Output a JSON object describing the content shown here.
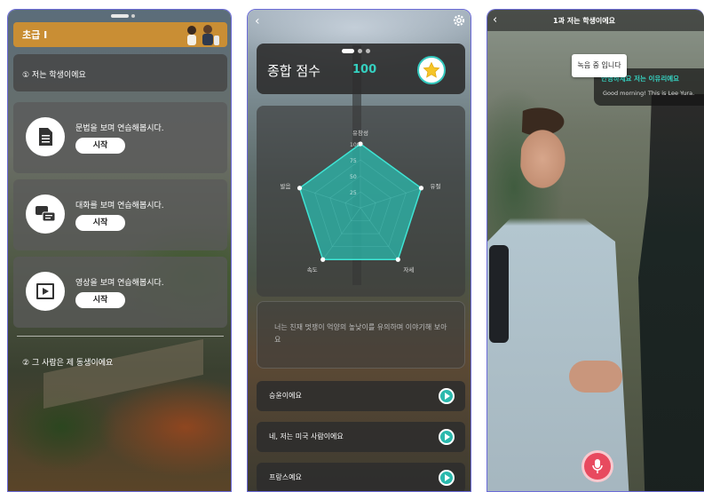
{
  "screen1": {
    "header_title": "초급 I",
    "lesson1_label": "① 저는 학생이에요",
    "cards": [
      {
        "icon": "document-icon",
        "title": "문법을 보며 연습해봅시다.",
        "button": "시작"
      },
      {
        "icon": "chat-icon",
        "title": "대화를 보며 연습해봅시다.",
        "button": "시작"
      },
      {
        "icon": "video-icon",
        "title": "영상을 보며 연습해봅시다.",
        "button": "시작"
      }
    ],
    "lesson2_label": "② 그 사람은 제 동생이에요"
  },
  "screen2": {
    "score_label": "종합 점수",
    "score_value": "100",
    "prompt": "너는 친재 멋쟁이 억양의 높낮이를 유의하며 이야기해 보아요",
    "answers": [
      "승윤이에요",
      "네, 저는 미국 사람이에요",
      "프랑스예요"
    ]
  },
  "chart_data": {
    "type": "radar",
    "axes": [
      "유창성",
      "유절",
      "자세",
      "속도",
      "발음"
    ],
    "values": [
      100,
      100,
      100,
      100,
      100
    ],
    "ticks": [
      "100",
      "75",
      "50",
      "25"
    ],
    "range": [
      0,
      100
    ],
    "fill_color": "#2bb9ad",
    "line_color": "#3fe3d3"
  },
  "screen3": {
    "title": "1과 저는 학생이에요",
    "recording_label": "녹음 중 입니다",
    "subtitle_ko": "안녕하세요 저는 이유리예요",
    "subtitle_en": "Good morning! This is Lee Yura."
  },
  "colors": {
    "accent": "#c98e34",
    "teal": "#2bb9ad",
    "mic": "#e84a5f"
  }
}
